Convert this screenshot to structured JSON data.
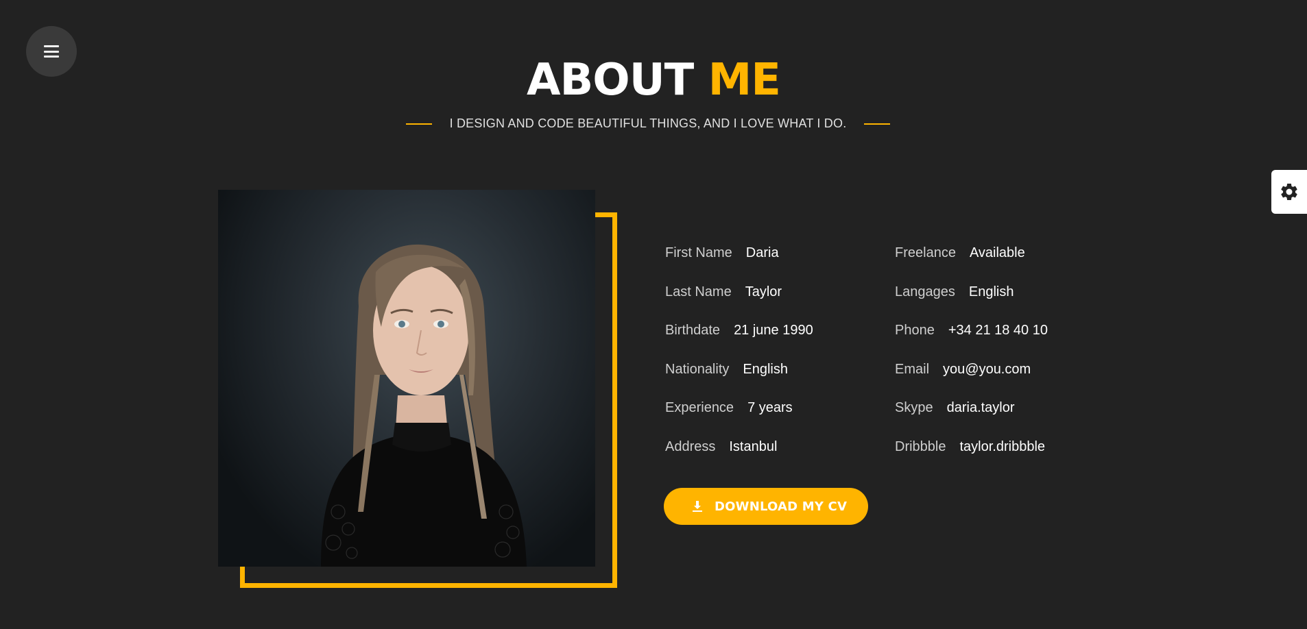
{
  "colors": {
    "background": "#222222",
    "accent": "#ffb400",
    "text": "#ffffff",
    "muted_text": "#cfcfcf"
  },
  "menu": {
    "icon": "hamburger-menu-icon"
  },
  "settings": {
    "icon": "gear-icon"
  },
  "header": {
    "title_main": "ABOUT",
    "title_accent": "ME",
    "subtitle": "I DESIGN AND CODE BEAUTIFUL THINGS, AND I LOVE WHAT I DO."
  },
  "profile_photo": {
    "icon": "portrait-photo"
  },
  "info": {
    "left": [
      {
        "label": "First Name",
        "value": "Daria"
      },
      {
        "label": "Last Name",
        "value": "Taylor"
      },
      {
        "label": "Birthdate",
        "value": "21 june 1990"
      },
      {
        "label": "Nationality",
        "value": "English"
      },
      {
        "label": "Experience",
        "value": "7 years"
      },
      {
        "label": "Address",
        "value": "Istanbul"
      }
    ],
    "right": [
      {
        "label": "Freelance",
        "value": "Available"
      },
      {
        "label": "Langages",
        "value": "English"
      },
      {
        "label": "Phone",
        "value": "+34 21 18 40 10"
      },
      {
        "label": "Email",
        "value": "you@you.com"
      },
      {
        "label": "Skype",
        "value": "daria.taylor"
      },
      {
        "label": "Dribbble",
        "value": "taylor.dribbble"
      }
    ]
  },
  "download": {
    "label": "DOWNLOAD MY CV",
    "icon": "download-icon"
  }
}
